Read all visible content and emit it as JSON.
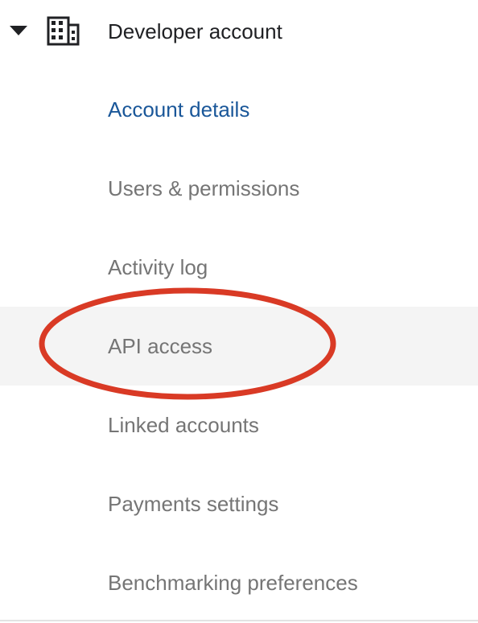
{
  "header": {
    "title": "Developer account",
    "expand_icon": "caret-down-icon",
    "section_icon": "building-icon"
  },
  "nav": {
    "items": [
      {
        "label": "Account details",
        "state": "active"
      },
      {
        "label": "Users & permissions",
        "state": "default"
      },
      {
        "label": "Activity log",
        "state": "default"
      },
      {
        "label": "API access",
        "state": "hover"
      },
      {
        "label": "Linked accounts",
        "state": "default"
      },
      {
        "label": "Payments settings",
        "state": "default"
      },
      {
        "label": "Benchmarking preferences",
        "state": "default"
      }
    ]
  },
  "colors": {
    "active_text": "#1a5799",
    "default_text": "#757575",
    "header_text": "#202124",
    "hover_bg": "#f4f4f4",
    "annotation": "#d93a25"
  },
  "annotation": {
    "shape": "ellipse",
    "highlights": "API access"
  }
}
